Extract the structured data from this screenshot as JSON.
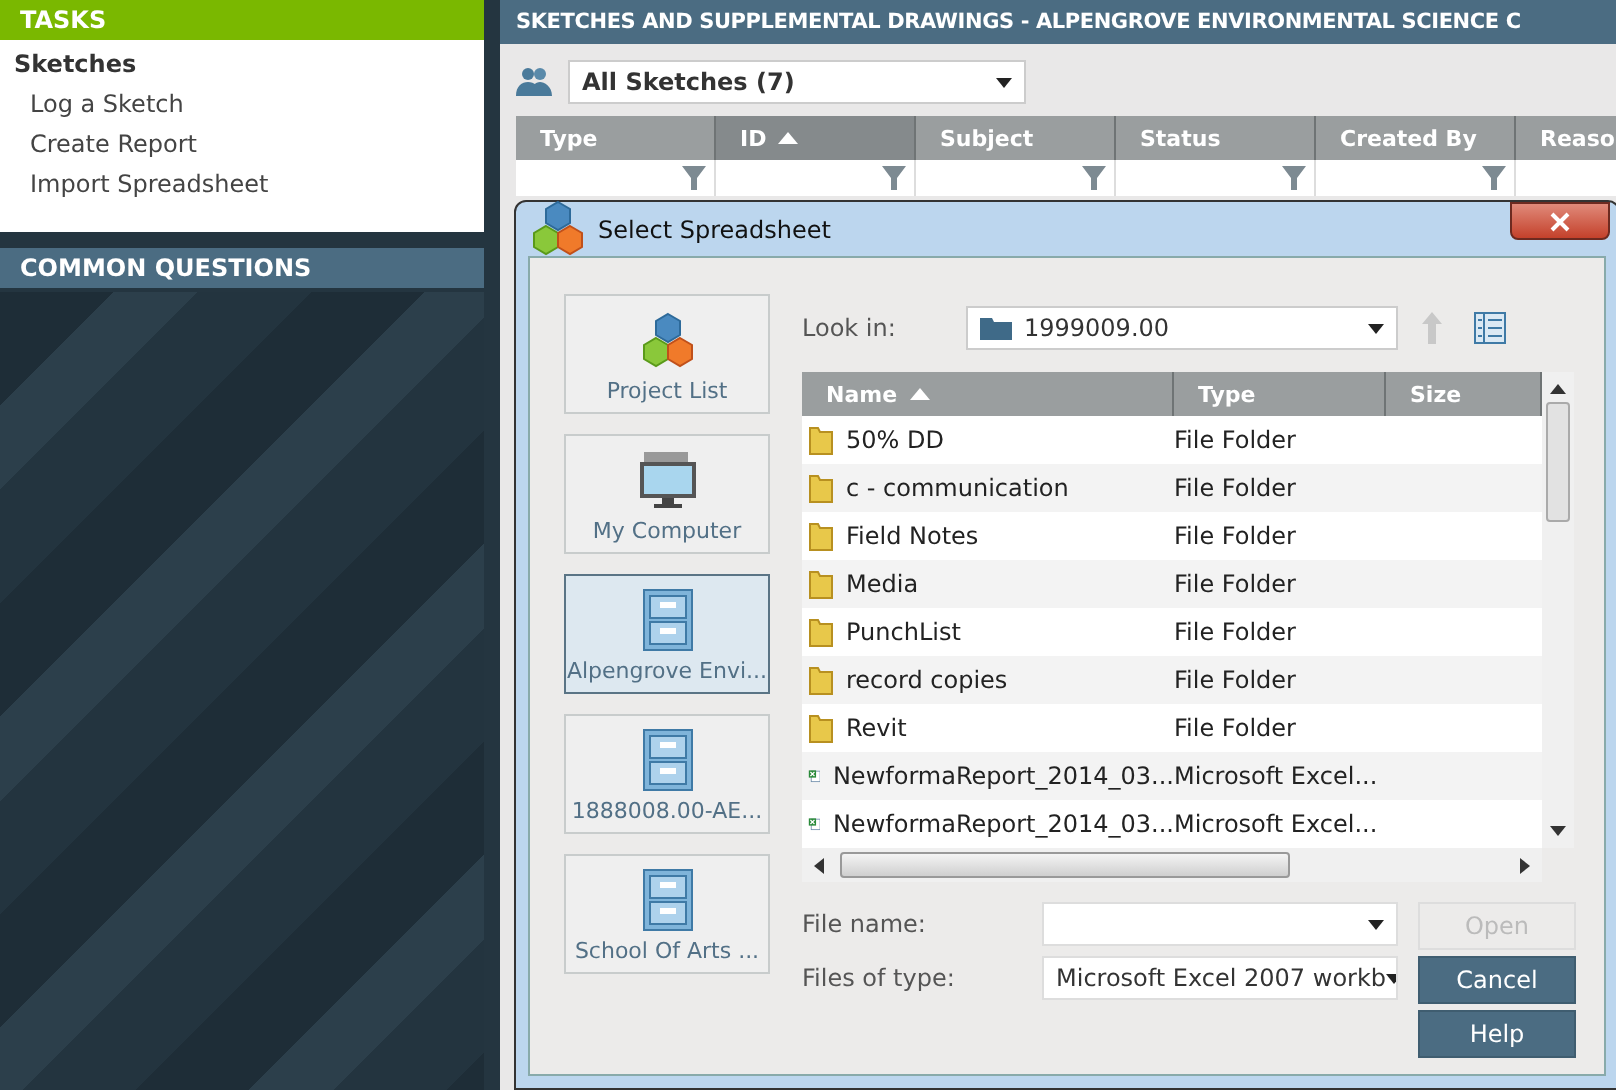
{
  "sidebar": {
    "tasks_header": "TASKS",
    "section": "Sketches",
    "items": [
      {
        "label": "Log a Sketch"
      },
      {
        "label": "Create Report"
      },
      {
        "label": "Import Spreadsheet"
      }
    ],
    "questions_header": "COMMON QUESTIONS"
  },
  "main": {
    "title": "SKETCHES AND SUPPLEMENTAL DRAWINGS - ALPENGROVE ENVIRONMENTAL SCIENCE C",
    "view": "All Sketches (7)",
    "columns": [
      {
        "label": "Type",
        "sorted": false
      },
      {
        "label": "ID",
        "sorted": true
      },
      {
        "label": "Subject",
        "sorted": false
      },
      {
        "label": "Status",
        "sorted": false
      },
      {
        "label": "Created By",
        "sorted": false
      },
      {
        "label": "Reaso",
        "sorted": false
      }
    ]
  },
  "dialog": {
    "title": "Select Spreadsheet",
    "places": [
      {
        "label": "Project List",
        "kind": "project",
        "selected": false
      },
      {
        "label": "My Computer",
        "kind": "computer",
        "selected": false
      },
      {
        "label": "Alpengrove Envi...",
        "kind": "cabinet",
        "selected": true
      },
      {
        "label": "1888008.00-AE...",
        "kind": "cabinet",
        "selected": false
      },
      {
        "label": "School Of Arts  ...",
        "kind": "cabinet",
        "selected": false
      }
    ],
    "look_in_label": "Look in:",
    "look_in": "1999009.00",
    "columns": [
      {
        "label": "Name",
        "sorted": true
      },
      {
        "label": "Type",
        "sorted": false
      },
      {
        "label": "Size",
        "sorted": false
      }
    ],
    "files": [
      {
        "name": "50% DD",
        "type": "File Folder",
        "kind": "folder"
      },
      {
        "name": "c - communication",
        "type": "File Folder",
        "kind": "folder"
      },
      {
        "name": "Field Notes",
        "type": "File Folder",
        "kind": "folder"
      },
      {
        "name": "Media",
        "type": "File Folder",
        "kind": "folder"
      },
      {
        "name": "PunchList",
        "type": "File Folder",
        "kind": "folder"
      },
      {
        "name": "record copies",
        "type": "File Folder",
        "kind": "folder"
      },
      {
        "name": "Revit",
        "type": "File Folder",
        "kind": "folder"
      },
      {
        "name": "NewformaReport_2014_03...",
        "type": "Microsoft Excel...",
        "kind": "excel"
      },
      {
        "name": "NewformaReport_2014_03...",
        "type": "Microsoft Excel...",
        "kind": "excel"
      }
    ],
    "file_name_label": "File name:",
    "file_type_label": "Files of type:",
    "file_type": "Microsoft Excel 2007 workb",
    "buttons": [
      {
        "label": "Open",
        "disabled": true
      },
      {
        "label": "Cancel",
        "disabled": false
      },
      {
        "label": "Help",
        "disabled": false
      }
    ]
  }
}
